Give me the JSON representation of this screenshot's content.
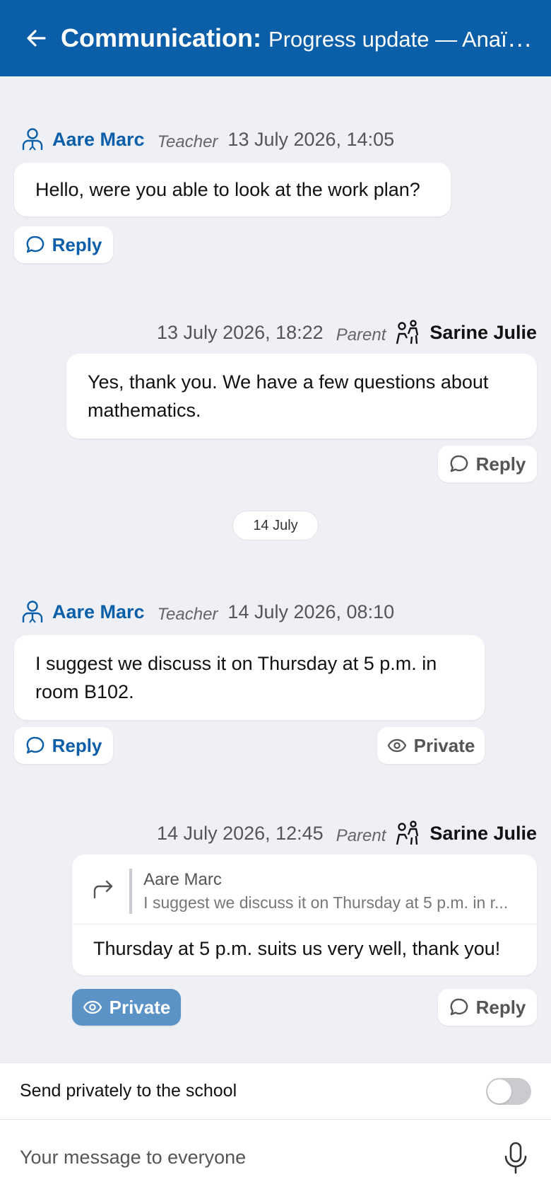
{
  "header": {
    "title_bold": "Communication:",
    "title_rest": "Progress update — Anaïs ..."
  },
  "messages": [
    {
      "author": "Aare Marc",
      "role": "Teacher",
      "datetime": "13 July 2026, 14:05",
      "text": "Hello, were you able to look at the work plan?",
      "reply_label": "Reply"
    },
    {
      "author": "Sarine Julie",
      "role": "Parent",
      "datetime": "13 July 2026, 18:22",
      "text": "Yes, thank you. We have a few questions about mathematics.",
      "reply_label": "Reply"
    },
    {
      "author": "Aare Marc",
      "role": "Teacher",
      "datetime": "14 July 2026, 08:10",
      "text": "I suggest we discuss it on Thursday at 5 p.m. in room B102.",
      "reply_label": "Reply",
      "private_label": "Private"
    },
    {
      "author": "Sarine Julie",
      "role": "Parent",
      "datetime": "14 July 2026, 12:45",
      "quote_author": "Aare Marc",
      "quote_text": "I suggest we discuss it on Thursday at 5 p.m. in r...",
      "text": "Thursday at 5 p.m. suits us very well, thank you!",
      "reply_label": "Reply",
      "private_label": "Private"
    }
  ],
  "date_divider": "14 July",
  "composer": {
    "private_toggle_label": "Send privately to the school",
    "private_toggle_on": false,
    "placeholder": "Your message to everyone"
  },
  "colors": {
    "brand": "#0b5ea8",
    "background": "#eef0f5",
    "private_active": "#5b93c7"
  }
}
